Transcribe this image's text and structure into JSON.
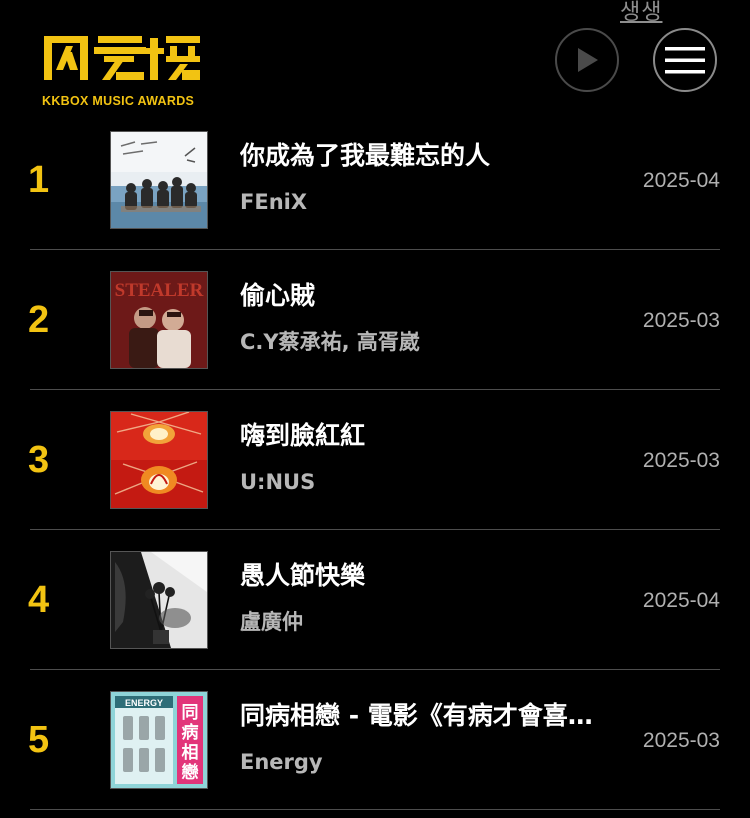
{
  "top_link": "생생",
  "logo": {
    "mark": "风云榜",
    "subtitle": "KKBOX MUSIC AWARDS"
  },
  "header": {
    "play_icon": "play-icon",
    "menu_icon": "menu-icon"
  },
  "colors": {
    "accent": "#f2c312",
    "background": "#000000",
    "artist_text": "#b7b7b7",
    "divider": "#4d4d4d"
  },
  "songs": [
    {
      "rank": "1",
      "title": "你成為了我最難忘的人",
      "artist": "FEniX",
      "date": "2025-04"
    },
    {
      "rank": "2",
      "title": "偷心賊",
      "artist": "C.Y蔡承祐, 高胥崴",
      "date": "2025-03"
    },
    {
      "rank": "3",
      "title": "嗨到臉紅紅",
      "artist": "U:NUS",
      "date": "2025-03"
    },
    {
      "rank": "4",
      "title": "愚人節快樂",
      "artist": "盧廣仲",
      "date": "2025-04"
    },
    {
      "rank": "5",
      "title": "同病相戀 - 電影《有病才會喜歡你》主題曲",
      "artist": "Energy",
      "date": "2025-03"
    }
  ],
  "covers": {
    "cover_2_text": "STEALER",
    "cover_5_text": "ENERGY",
    "cover_5_side": "同病相戀"
  }
}
